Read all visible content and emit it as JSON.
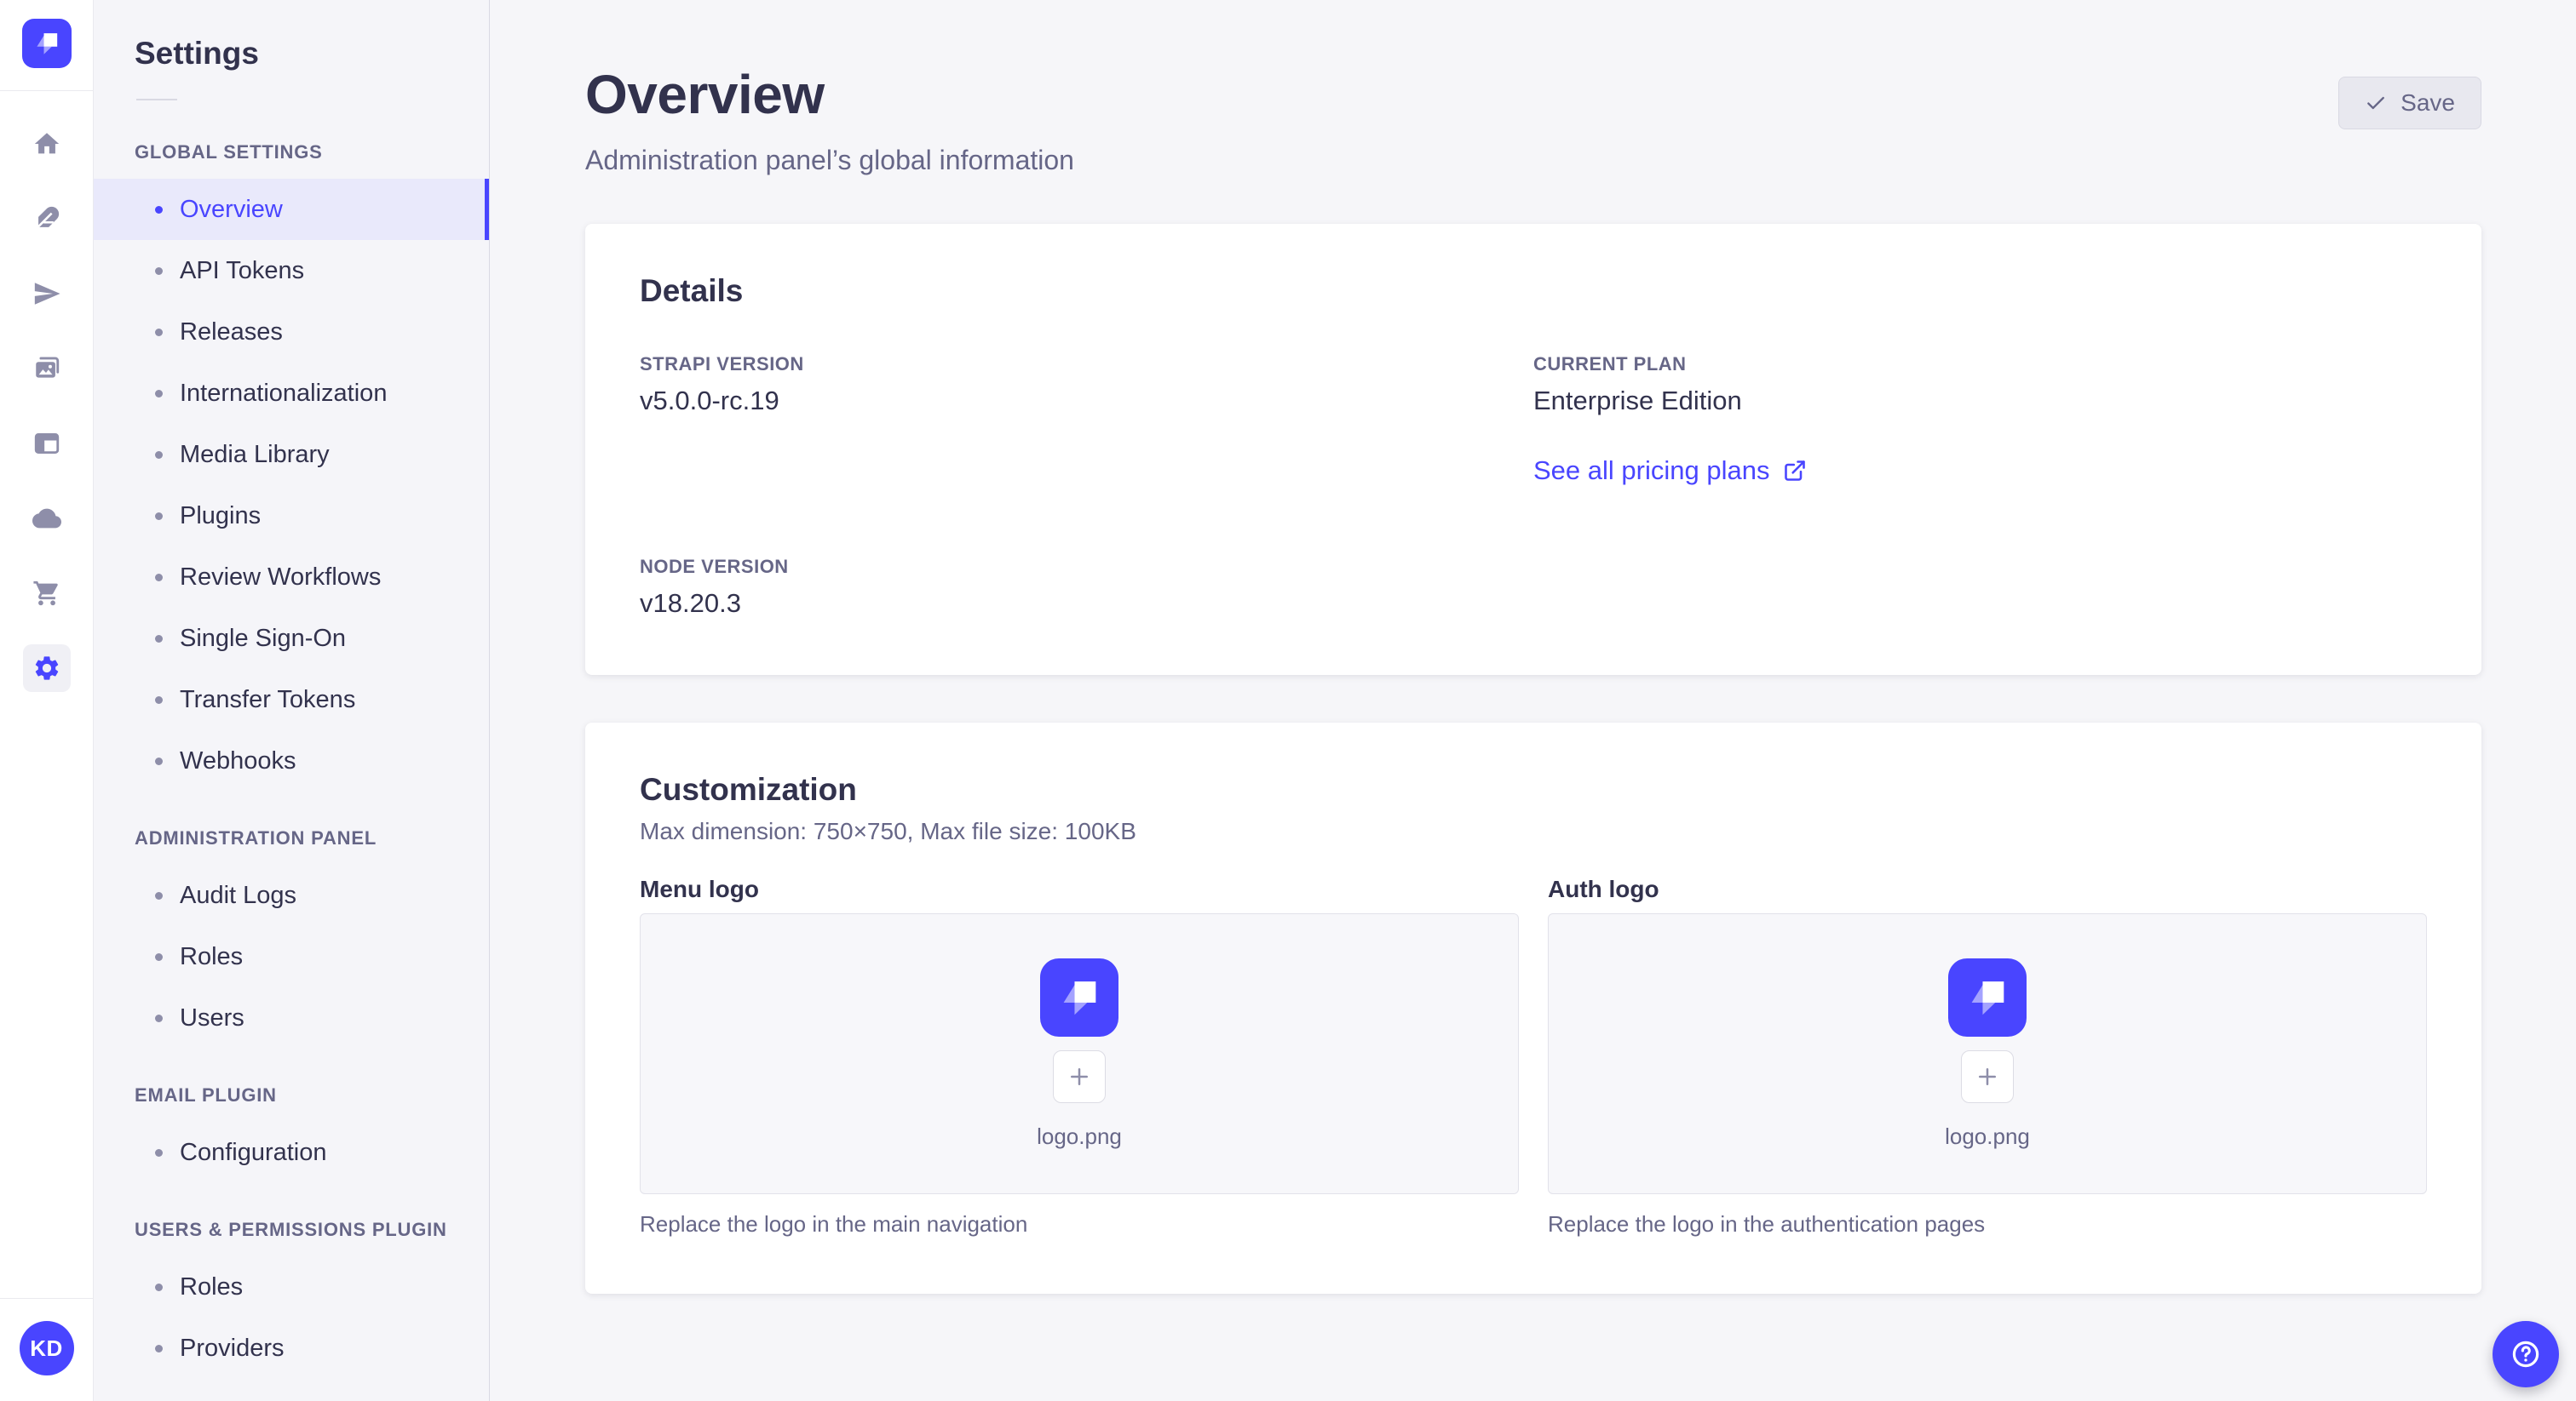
{
  "colors": {
    "primary": "#4945ff",
    "primary_bg": "#e9e9fb",
    "text": "#32324d",
    "muted": "#666687",
    "icon": "#8e8ea9",
    "border": "#dcdce4",
    "surface": "#ffffff",
    "background": "#f6f6f9"
  },
  "rail": {
    "logo_icon": "strapi-logo",
    "icons": [
      "home-icon",
      "feather-icon",
      "paper-plane-icon",
      "images-icon",
      "layout-icon",
      "cloud-icon",
      "cart-icon",
      "settings-gear-icon"
    ],
    "active_icon": "settings-gear-icon",
    "avatar_initials": "KD"
  },
  "sidebar": {
    "title": "Settings",
    "sections": [
      {
        "label": "GLOBAL SETTINGS",
        "items": [
          {
            "label": "Overview",
            "active": true
          },
          {
            "label": "API Tokens",
            "active": false
          },
          {
            "label": "Releases",
            "active": false
          },
          {
            "label": "Internationalization",
            "active": false
          },
          {
            "label": "Media Library",
            "active": false
          },
          {
            "label": "Plugins",
            "active": false
          },
          {
            "label": "Review Workflows",
            "active": false
          },
          {
            "label": "Single Sign-On",
            "active": false
          },
          {
            "label": "Transfer Tokens",
            "active": false
          },
          {
            "label": "Webhooks",
            "active": false
          }
        ]
      },
      {
        "label": "ADMINISTRATION PANEL",
        "items": [
          {
            "label": "Audit Logs",
            "active": false
          },
          {
            "label": "Roles",
            "active": false
          },
          {
            "label": "Users",
            "active": false
          }
        ]
      },
      {
        "label": "EMAIL PLUGIN",
        "items": [
          {
            "label": "Configuration",
            "active": false
          }
        ]
      },
      {
        "label": "USERS & PERMISSIONS PLUGIN",
        "items": [
          {
            "label": "Roles",
            "active": false
          },
          {
            "label": "Providers",
            "active": false
          }
        ]
      }
    ]
  },
  "header": {
    "title": "Overview",
    "subtitle": "Administration panel’s global information",
    "save_label": "Save"
  },
  "details": {
    "title": "Details",
    "fields": [
      {
        "label": "STRAPI VERSION",
        "value": "v5.0.0-rc.19"
      },
      {
        "label": "CURRENT PLAN",
        "value": "Enterprise Edition"
      },
      {
        "label": "NODE VERSION",
        "value": "v18.20.3"
      }
    ],
    "link": "See all pricing plans"
  },
  "customization": {
    "title": "Customization",
    "subtitle": "Max dimension: 750×750, Max file size: 100KB",
    "logos": [
      {
        "label": "Menu logo",
        "filename": "logo.png",
        "hint": "Replace the logo in the main navigation"
      },
      {
        "label": "Auth logo",
        "filename": "logo.png",
        "hint": "Replace the logo in the authentication pages"
      }
    ]
  },
  "help": {
    "icon": "question-circle-icon"
  }
}
